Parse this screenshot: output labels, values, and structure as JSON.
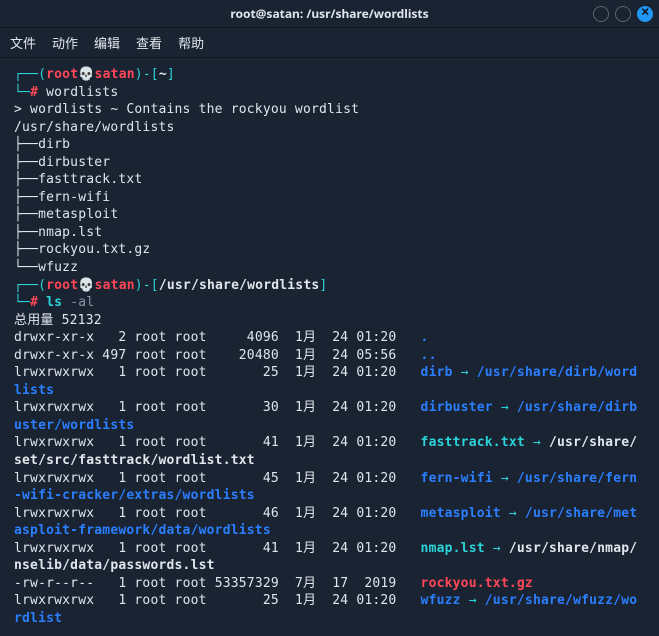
{
  "titlebar": {
    "title": "root@satan: /usr/share/wordlists"
  },
  "menubar": {
    "file": "文件",
    "actions": "动作",
    "edit": "编辑",
    "view": "查看",
    "help": "帮助"
  },
  "prompt1": {
    "open": "┌──(",
    "user": "root",
    "skull": "💀",
    "host": "satan",
    "close_paren": ")",
    "dash": "-[",
    "path": "~",
    "end": "]",
    "line2_prefix": "└─",
    "hash": "#",
    "cmd": " wordlists"
  },
  "desc": {
    "line": "> wordlists ~ Contains the rockyou wordlist",
    "path": "/usr/share/wordlists",
    "tree": [
      "├──dirb",
      "├──dirbuster",
      "├──fasttrack.txt",
      "├──fern-wifi",
      "├──metasploit",
      "├──nmap.lst",
      "├──rockyou.txt.gz",
      "└──wfuzz"
    ]
  },
  "prompt2": {
    "open": "┌──(",
    "user": "root",
    "skull": "💀",
    "host": "satan",
    "close_paren": ")",
    "dash": "-[",
    "path": "/usr/share/wordlists",
    "end": "]",
    "line2_prefix": "└─",
    "hash": "#",
    "cmd_ls": " ls ",
    "cmd_flag": "-al"
  },
  "ls": {
    "total": "总用量 52132",
    "rows": [
      {
        "perm": "drwxr-xr-x",
        "links": "2",
        "own": "root root",
        "size": "4096",
        "date": "1月  24 01:20",
        "name": ".",
        "nameClass": "bblue",
        "arrow": "",
        "target": "",
        "targetClass": ""
      },
      {
        "perm": "drwxr-xr-x",
        "links": "497",
        "own": "root root",
        "size": "20480",
        "date": "1月  24 05:56",
        "name": "..",
        "nameClass": "bblue",
        "arrow": "",
        "target": "",
        "targetClass": ""
      },
      {
        "perm": "lrwxrwxrwx",
        "links": "1",
        "own": "root root",
        "size": "25",
        "date": "1月  24 01:20",
        "name": "dirb",
        "nameClass": "bblue",
        "arrow": " → ",
        "target": "/usr/share/dirb/wordlists",
        "targetClass": "bblue"
      },
      {
        "perm": "lrwxrwxrwx",
        "links": "1",
        "own": "root root",
        "size": "30",
        "date": "1月  24 01:20",
        "name": "dirbuster",
        "nameClass": "bblue",
        "arrow": " → ",
        "target": "/usr/share/dirbuster/wordlists",
        "targetClass": "bblue"
      },
      {
        "perm": "lrwxrwxrwx",
        "links": "1",
        "own": "root root",
        "size": "41",
        "date": "1月  24 01:20",
        "name": "fasttrack.txt",
        "nameClass": "cyan",
        "arrow": " → ",
        "target": "/usr/share/set/src/fasttrack/wordlist.txt",
        "targetClass": "white"
      },
      {
        "perm": "lrwxrwxrwx",
        "links": "1",
        "own": "root root",
        "size": "45",
        "date": "1月  24 01:20",
        "name": "fern-wifi",
        "nameClass": "bblue",
        "arrow": " → ",
        "target": "/usr/share/fern-wifi-cracker/extras/wordlists",
        "targetClass": "bblue"
      },
      {
        "perm": "lrwxrwxrwx",
        "links": "1",
        "own": "root root",
        "size": "46",
        "date": "1月  24 01:20",
        "name": "metasploit",
        "nameClass": "bblue",
        "arrow": " → ",
        "target": "/usr/share/metasploit-framework/data/wordlists",
        "targetClass": "bblue"
      },
      {
        "perm": "lrwxrwxrwx",
        "links": "1",
        "own": "root root",
        "size": "41",
        "date": "1月  24 01:20",
        "name": "nmap.lst",
        "nameClass": "cyan",
        "arrow": " → ",
        "target": "/usr/share/nmap/nselib/data/passwords.lst",
        "targetClass": "white"
      },
      {
        "perm": "-rw-r--r--",
        "links": "1",
        "own": "root root",
        "size": "53357329",
        "date": "7月  17  2019",
        "name": "rockyou.txt.gz",
        "nameClass": "red",
        "arrow": "",
        "target": "",
        "targetClass": ""
      },
      {
        "perm": "lrwxrwxrwx",
        "links": "1",
        "own": "root root",
        "size": "25",
        "date": "1月  24 01:20",
        "name": "wfuzz",
        "nameClass": "bblue",
        "arrow": " → ",
        "target": "/usr/share/wfuzz/wordlist",
        "targetClass": "bblue"
      }
    ]
  }
}
